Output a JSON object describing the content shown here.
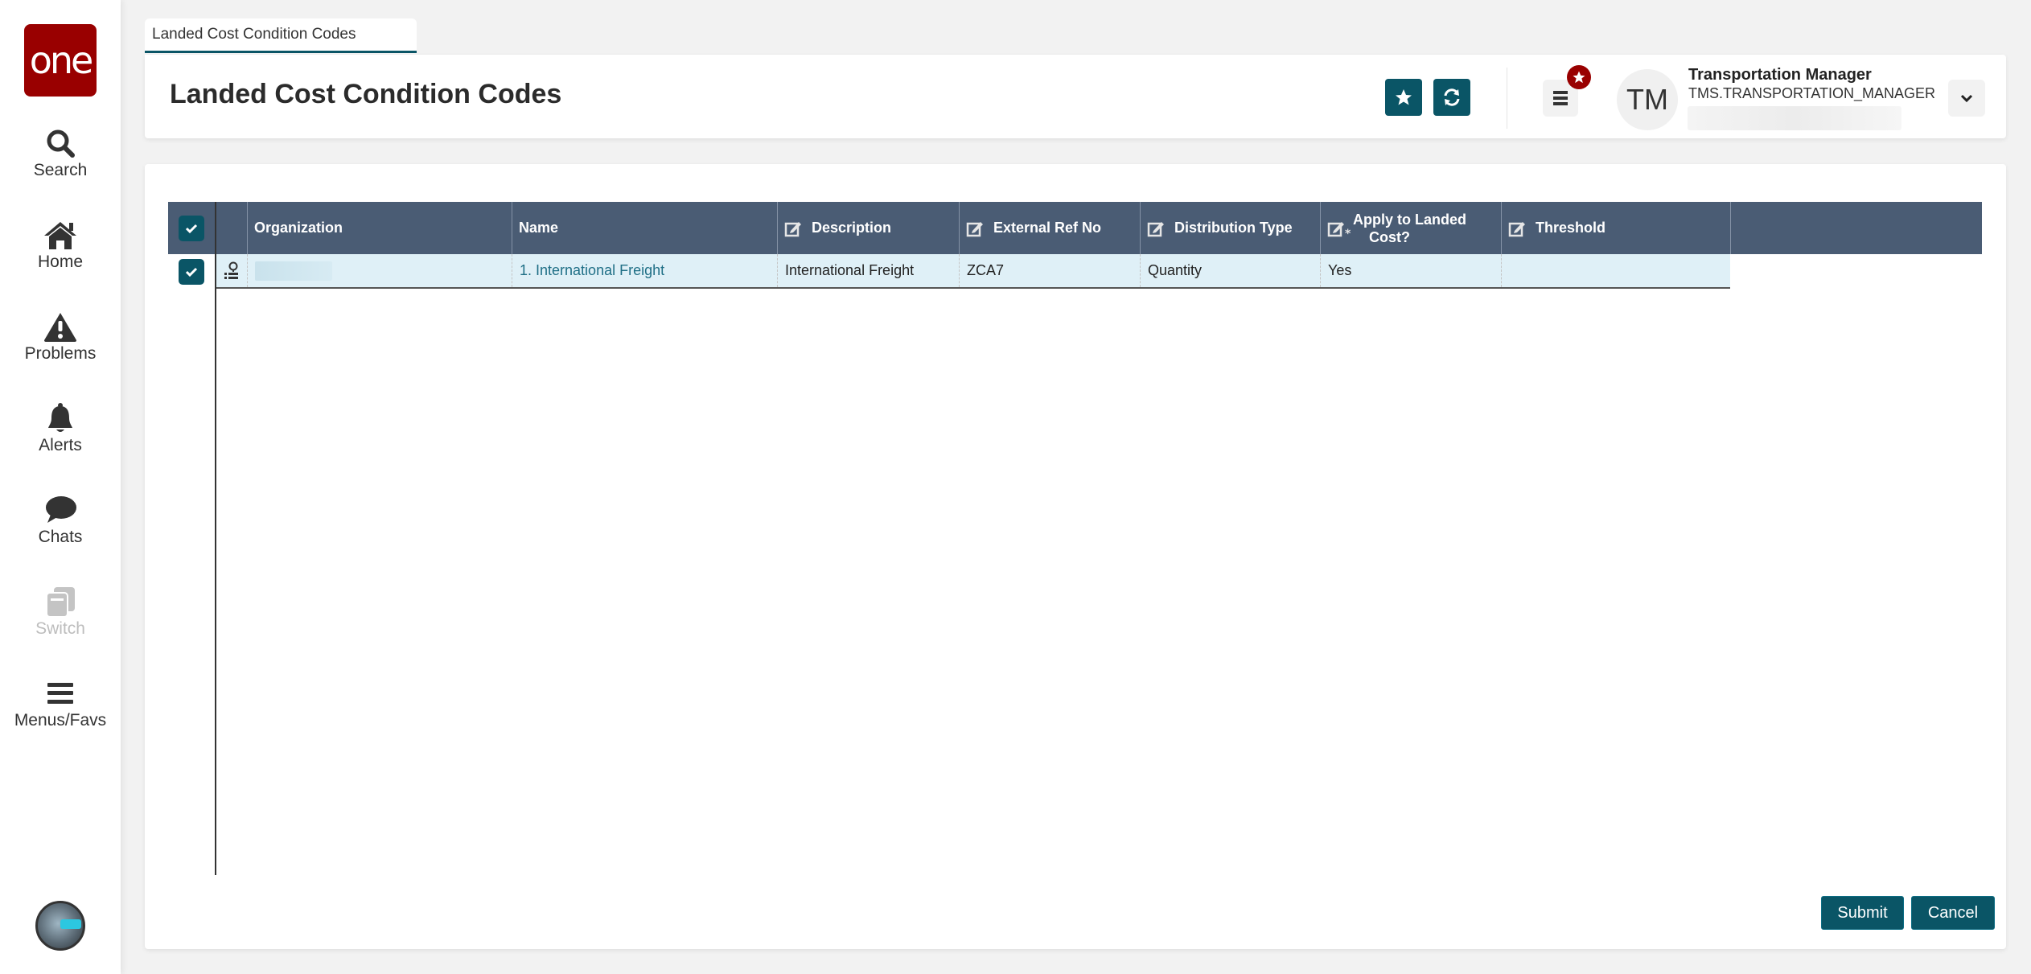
{
  "sidebar": {
    "logo_text": "one",
    "items": [
      {
        "label": "Search",
        "icon": "search-icon"
      },
      {
        "label": "Home",
        "icon": "home-icon"
      },
      {
        "label": "Problems",
        "icon": "warning-icon"
      },
      {
        "label": "Alerts",
        "icon": "bell-icon"
      },
      {
        "label": "Chats",
        "icon": "chat-icon"
      },
      {
        "label": "Switch",
        "icon": "switch-icon",
        "disabled": true
      },
      {
        "label": "Menus/Favs",
        "icon": "menu-icon"
      }
    ]
  },
  "tab": {
    "label": "Landed Cost Condition Codes"
  },
  "header": {
    "title": "Landed Cost Condition Codes",
    "user": {
      "initials": "TM",
      "name": "Transportation Manager",
      "id": "TMS.TRANSPORTATION_MANAGER"
    }
  },
  "table": {
    "columns": [
      {
        "label": "Organization",
        "editable": false
      },
      {
        "label": "Name",
        "editable": false
      },
      {
        "label": "Description",
        "editable": true
      },
      {
        "label": "External Ref No",
        "editable": true
      },
      {
        "label": "Distribution Type",
        "editable": true
      },
      {
        "label": "Apply to Landed Cost?",
        "label_line1": "Apply to Landed",
        "label_line2": "Cost?",
        "editable": true,
        "required": true
      },
      {
        "label": "Threshold",
        "editable": true
      }
    ],
    "rows": [
      {
        "selected": true,
        "organization": "",
        "name": "1. International Freight",
        "description": "International Freight",
        "external_ref_no": "ZCA7",
        "distribution_type": "Quantity",
        "apply_to_landed_cost": "Yes",
        "threshold": ""
      }
    ],
    "select_all": true
  },
  "actions": {
    "submit_label": "Submit",
    "cancel_label": "Cancel"
  },
  "colors": {
    "brand": "#990000",
    "accent": "#0a5566",
    "table_header": "#4a5c74",
    "row_selected": "#dff0f7",
    "link": "#1f6f86"
  }
}
